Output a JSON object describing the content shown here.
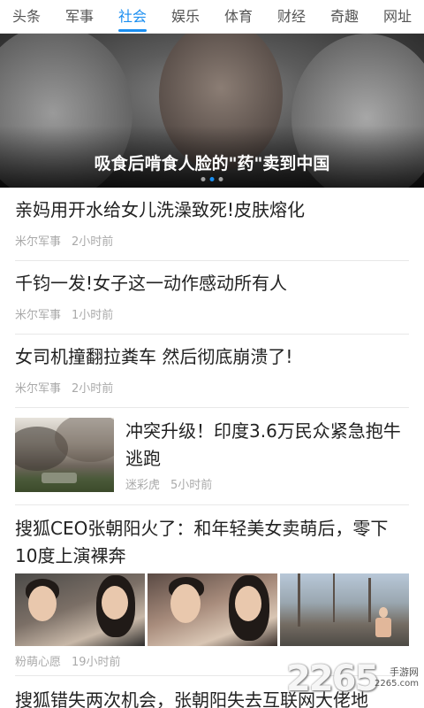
{
  "tabs": [
    {
      "label": "头条",
      "active": false
    },
    {
      "label": "军事",
      "active": false
    },
    {
      "label": "社会",
      "active": true
    },
    {
      "label": "娱乐",
      "active": false
    },
    {
      "label": "体育",
      "active": false
    },
    {
      "label": "财经",
      "active": false
    },
    {
      "label": "奇趣",
      "active": false
    },
    {
      "label": "网址",
      "active": false
    }
  ],
  "hero": {
    "title": "吸食后啃食人脸的\"药\"卖到中国",
    "dots": 3,
    "active_dot": 1
  },
  "news": [
    {
      "title": "亲妈用开水给女儿洗澡致死!皮肤熔化",
      "source": "米尔军事",
      "time": "2小时前"
    },
    {
      "title": "千钧一发!女子这一动作感动所有人",
      "source": "米尔军事",
      "time": "1小时前"
    },
    {
      "title": "女司机撞翻拉粪车 然后彻底崩溃了!",
      "source": "米尔军事",
      "time": "2小时前"
    },
    {
      "title": "冲突升级！印度3.6万民众紧急抱牛逃跑",
      "source": "迷彩虎",
      "time": "5小时前"
    },
    {
      "title": "搜狐CEO张朝阳火了：和年轻美女卖萌后，零下10度上演裸奔",
      "source": "粉萌心愿",
      "time": "19小时前"
    },
    {
      "title": "搜狐错失两次机会，张朝阳失去互联网大佬地"
    }
  ],
  "watermark": {
    "number": "2265",
    "site_cn": "手游网",
    "site_url": "2265.com"
  },
  "colors": {
    "accent": "#1a8ef0",
    "meta_text": "#aaaaaa",
    "title_text": "#222222"
  }
}
